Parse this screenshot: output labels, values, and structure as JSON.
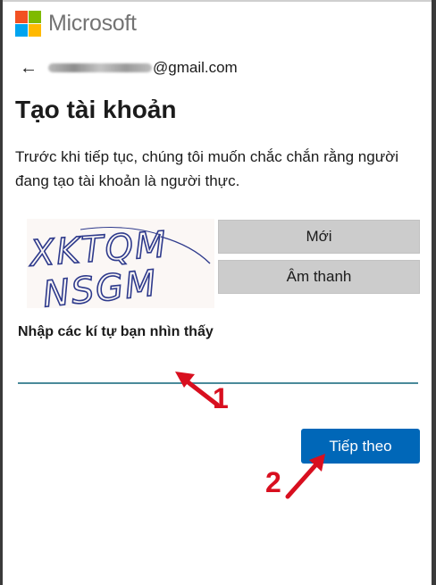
{
  "brand": {
    "name": "Microsoft"
  },
  "account": {
    "email_suffix": "@gmail.com"
  },
  "page": {
    "title": "Tạo tài khoản",
    "description": "Trước khi tiếp tục, chúng tôi muốn chắc chắn rằng người đang tạo tài khoản là người thực."
  },
  "captcha": {
    "line1": "XKTQM",
    "line2": "NSGM",
    "new_label": "Mới",
    "audio_label": "Âm thanh"
  },
  "input": {
    "label": "Nhập các kí tự bạn nhìn thấy",
    "value": ""
  },
  "actions": {
    "next_label": "Tiếp theo"
  },
  "annotations": {
    "step1": "1",
    "step2": "2"
  },
  "colors": {
    "primary": "#0067b8",
    "annotation": "#d80f1f",
    "input_underline": "#4a8a9a"
  },
  "icons": {
    "back": "back-arrow-icon"
  }
}
